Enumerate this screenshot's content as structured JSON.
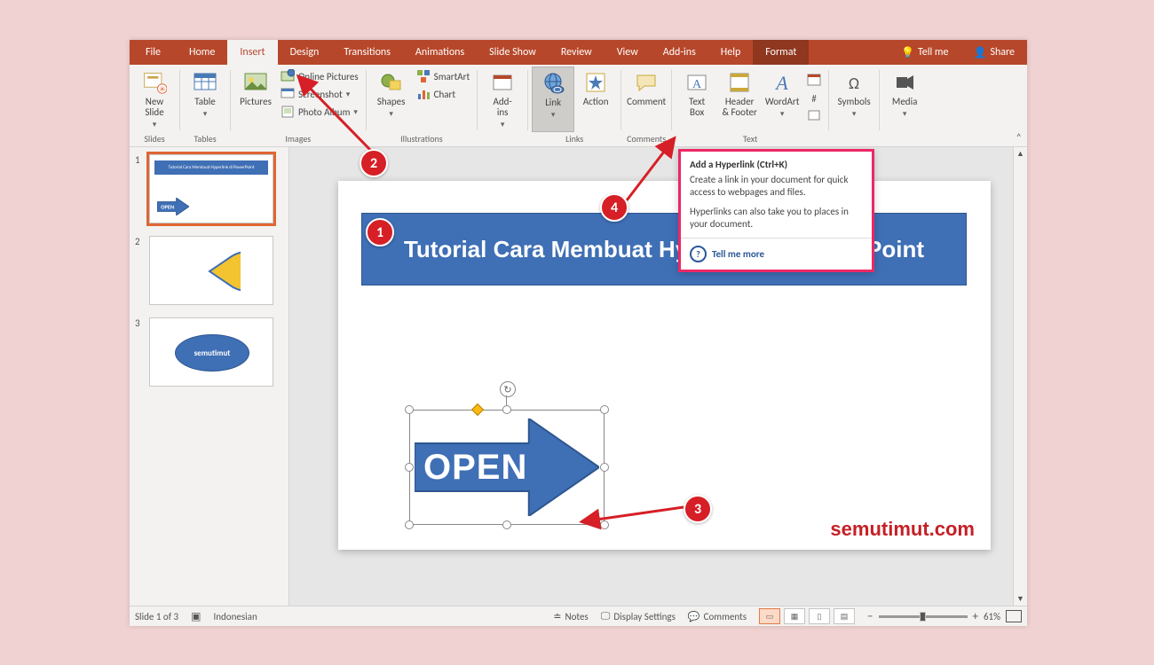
{
  "tabs": {
    "file": "File",
    "home": "Home",
    "insert": "Insert",
    "design": "Design",
    "transitions": "Transitions",
    "animations": "Animations",
    "slideshow": "Slide Show",
    "review": "Review",
    "view": "View",
    "addins": "Add-ins",
    "help": "Help",
    "format": "Format",
    "tellme": "Tell me",
    "share": "Share"
  },
  "ribbon": {
    "groups": {
      "slides": "Slides",
      "tables": "Tables",
      "images": "Images",
      "illustrations": "Illustrations",
      "addins_g": "",
      "links": "Links",
      "comments": "Comments",
      "text": "Text",
      "symbols": "",
      "media": ""
    },
    "new_slide": "New\nSlide",
    "table": "Table",
    "pictures": "Pictures",
    "online_pictures": "Online Pictures",
    "screenshot": "Screenshot",
    "photo_album": "Photo Album",
    "shapes": "Shapes",
    "smartart": "SmartArt",
    "chart": "Chart",
    "addins": "Add-\nins",
    "link": "Link",
    "action": "Action",
    "comment": "Comment",
    "textbox": "Text\nBox",
    "headerfooter": "Header\n& Footer",
    "wordart": "WordArt",
    "symbols_btn": "Symbols",
    "media": "Media"
  },
  "tooltip": {
    "title": "Add a Hyperlink (Ctrl+K)",
    "body1": "Create a link in your document for quick access to webpages and files.",
    "body2": "Hyperlinks can also take you to places in your document.",
    "more": "Tell me more"
  },
  "thumbs": {
    "n1": "1",
    "n2": "2",
    "n3": "3",
    "banner_mini": "Tutorial Cara Membuat Hyperlink di PowerPoint",
    "open_mini": "OPEN",
    "semutimut_mini": "semutimut"
  },
  "slide": {
    "banner": "Tutorial Cara Membuat Hyperlink di PowerPoint",
    "open": "OPEN",
    "watermark": "semutimut.com"
  },
  "status": {
    "slide_of": "Slide 1 of 3",
    "lang": "Indonesian",
    "notes": "Notes",
    "display": "Display Settings",
    "comments": "Comments",
    "zoom": "61%",
    "plus": "+",
    "minus": "−"
  },
  "callouts": {
    "c1": "1",
    "c2": "2",
    "c3": "3",
    "c4": "4"
  }
}
